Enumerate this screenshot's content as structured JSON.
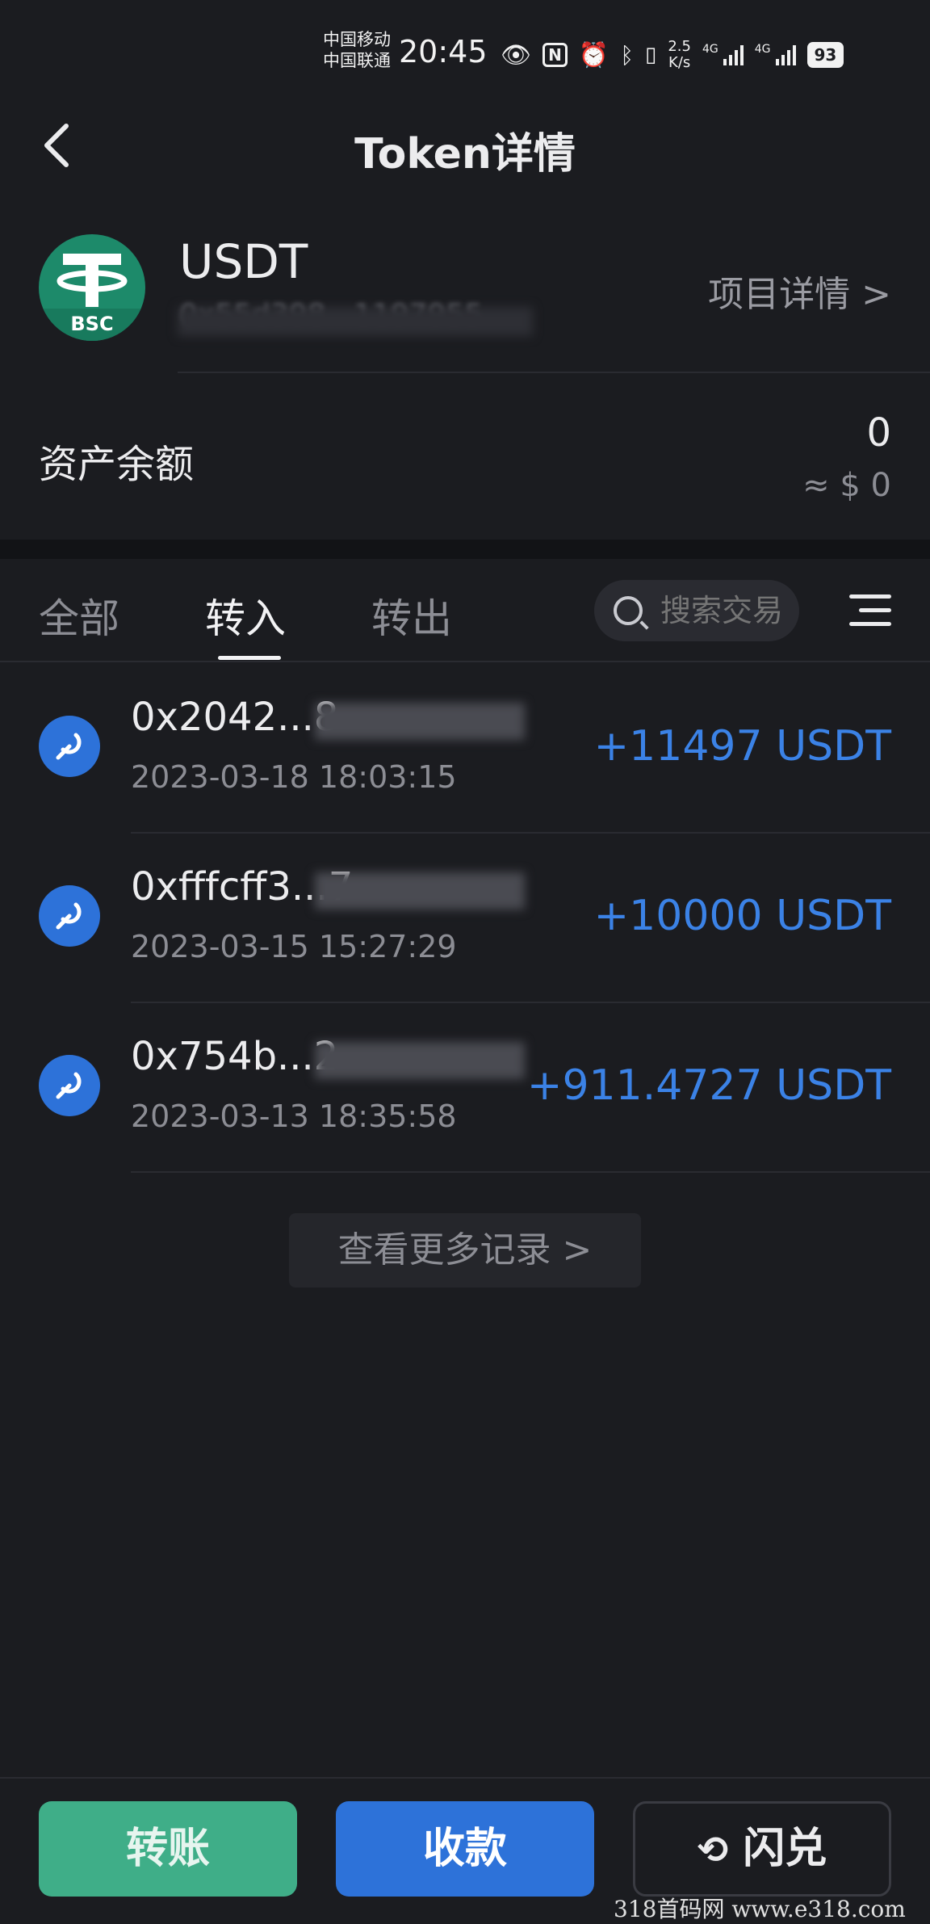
{
  "status_bar": {
    "carrier1": "中国移动",
    "carrier2": "中国联通",
    "time": "20:45",
    "speed_value": "2.5",
    "speed_unit": "K/s",
    "net1": "4G",
    "net2": "4G",
    "battery": "93"
  },
  "header": {
    "title": "Token详情"
  },
  "token": {
    "symbol": "USDT",
    "chain_badge": "BSC",
    "address_partial": "0x55d398...1197955",
    "project_link": "项目详情 >",
    "balance_label": "资产余额",
    "balance": "0",
    "balance_usd": "≈ $ 0"
  },
  "tabs": [
    {
      "label": "全部",
      "active": false
    },
    {
      "label": "转入",
      "active": true
    },
    {
      "label": "转出",
      "active": false
    }
  ],
  "search": {
    "placeholder": "搜索交易"
  },
  "transactions": [
    {
      "hash": "0x2042...8",
      "date": "2023-03-18 18:03:15",
      "amount": "+11497 USDT"
    },
    {
      "hash": "0xfffcff3...7",
      "date": "2023-03-15 15:27:29",
      "amount": "+10000 USDT"
    },
    {
      "hash": "0x754b...2",
      "date": "2023-03-13 18:35:58",
      "amount": "+911.4727 USDT"
    }
  ],
  "more_records": "查看更多记录 >",
  "actions": {
    "transfer": "转账",
    "receive": "收款",
    "swap": "闪兑"
  },
  "watermark": "318首码网  www.e318.com",
  "colors": {
    "background": "#1b1c20",
    "accent_blue": "#2d72d9",
    "amount_blue": "#3b82e6",
    "green": "#3fae88",
    "token_green": "#1d8a6a"
  }
}
